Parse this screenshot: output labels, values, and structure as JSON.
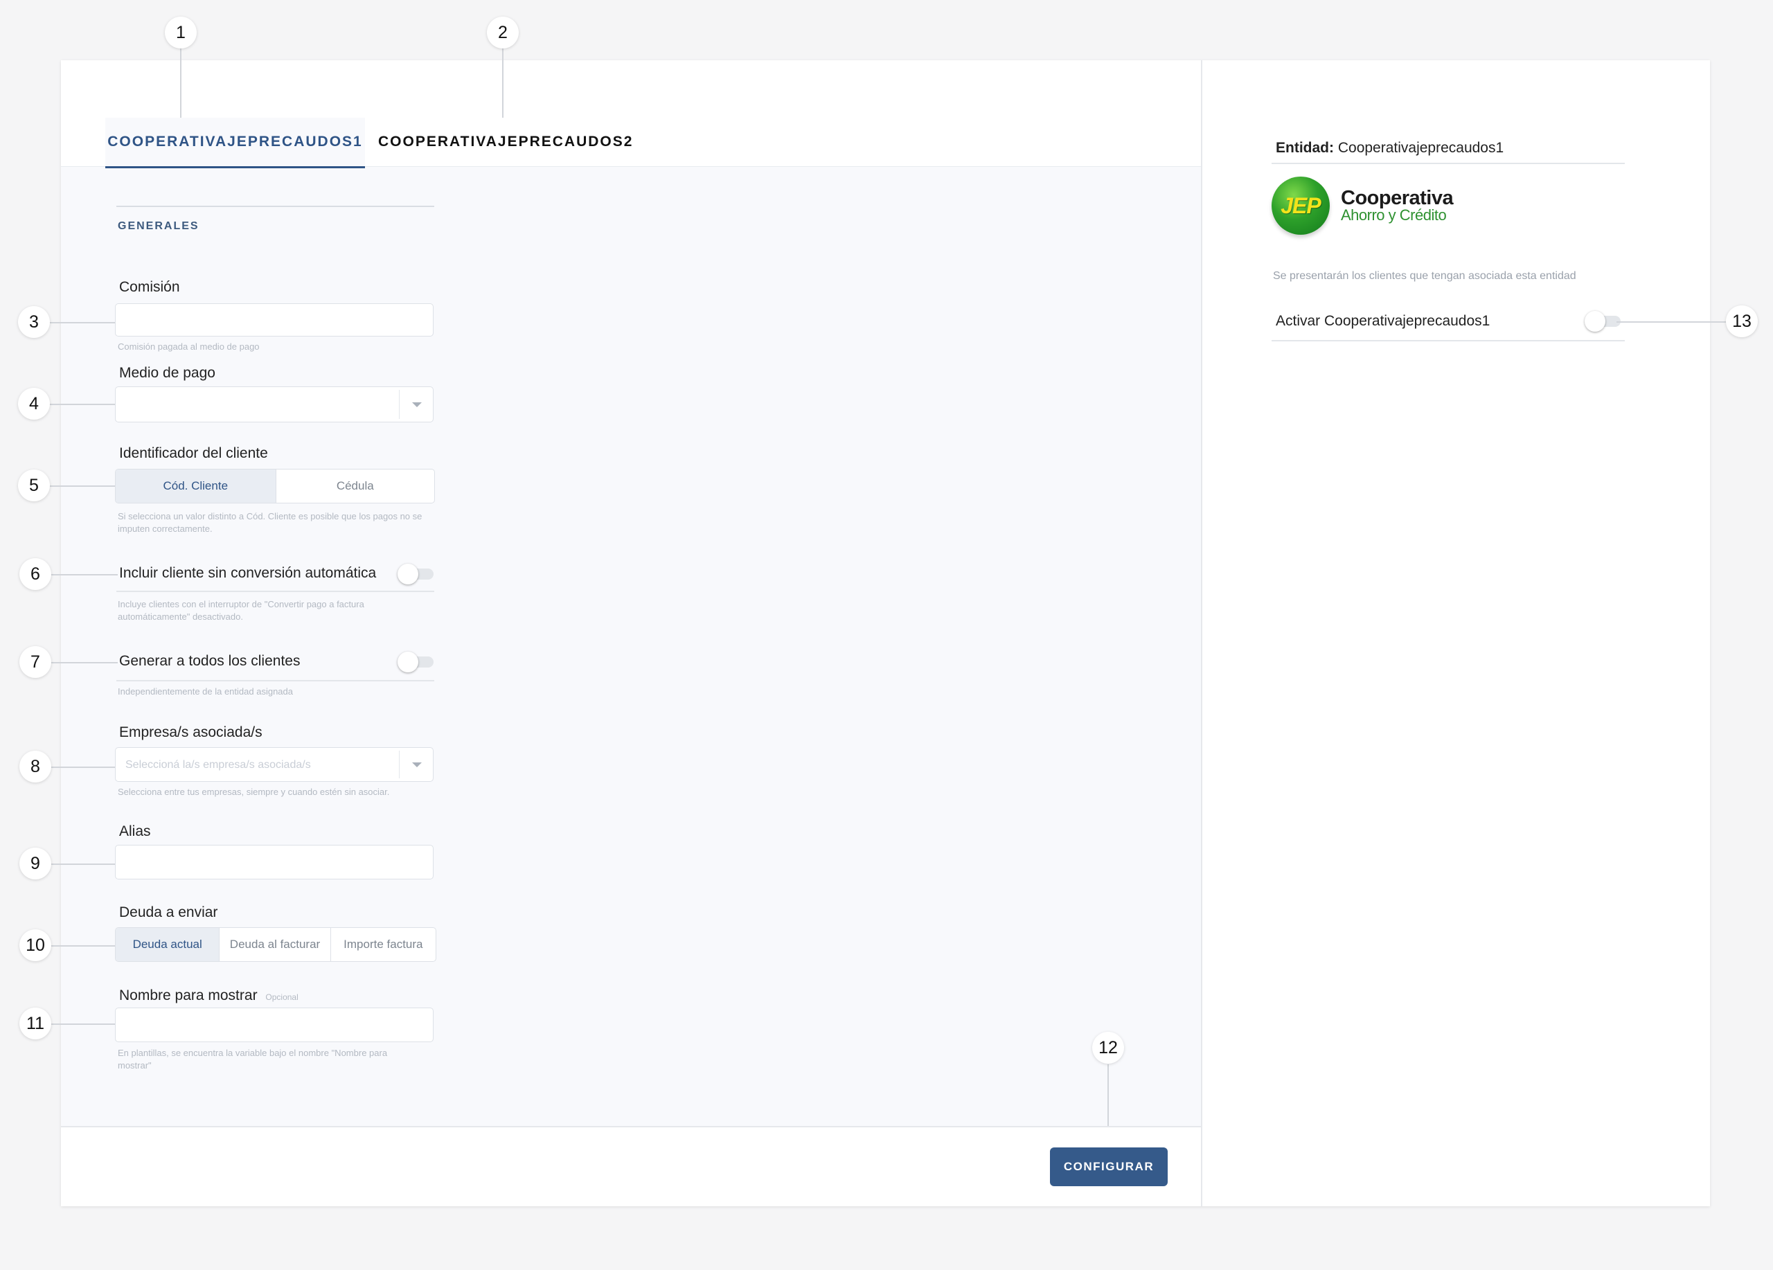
{
  "tabs": [
    {
      "label": "COOPERATIVAJEPRECAUDOS1",
      "active": true
    },
    {
      "label": "COOPERATIVAJEPRECAUDOS2",
      "active": false
    }
  ],
  "section": {
    "title": "GENERALES"
  },
  "fields": {
    "comision": {
      "label": "Comisión",
      "value": "",
      "help": "Comisión pagada al medio de pago"
    },
    "medio_pago": {
      "label": "Medio de pago",
      "value": ""
    },
    "identificador": {
      "label": "Identificador del cliente",
      "options": [
        "Cód. Cliente",
        "Cédula"
      ],
      "selected": "Cód. Cliente",
      "help": "Si selecciona un valor distinto a Cód. Cliente es posible que los pagos no se imputen correctamente."
    },
    "incluir_cliente": {
      "label": "Incluir cliente sin conversión automática",
      "checked": false,
      "help": "Incluye clientes con el interruptor de \"Convertir pago a factura automáticamente\" desactivado."
    },
    "generar_todos": {
      "label": "Generar a todos los clientes",
      "checked": false,
      "help": "Independientemente de la entidad asignada"
    },
    "empresas": {
      "label": "Empresa/s asociada/s",
      "placeholder": "Seleccioná la/s empresa/s asociada/s",
      "help": "Selecciona entre tus empresas, siempre y cuando estén sin asociar."
    },
    "alias": {
      "label": "Alias",
      "value": ""
    },
    "deuda": {
      "label": "Deuda a enviar",
      "options": [
        "Deuda actual",
        "Deuda al facturar",
        "Importe factura"
      ],
      "selected": "Deuda actual"
    },
    "nombre_mostrar": {
      "label": "Nombre para mostrar",
      "optional": "Opcional",
      "value": "",
      "help": "En plantillas, se encuentra la variable bajo el nombre \"Nombre para mostrar\""
    }
  },
  "footer": {
    "button_label": "CONFIGURAR"
  },
  "entity_panel": {
    "entidad_label": "Entidad:",
    "entidad_value": "Cooperativajeprecaudos1",
    "logo": {
      "mark": "JEP",
      "line1": "Cooperativa",
      "line2": "Ahorro y Crédito",
      "colors": {
        "ball": "#2da02a",
        "mark": "#f3e31b",
        "line2": "#2e9130"
      }
    },
    "help": "Se presentarán los clientes que tengan asociada esta entidad",
    "activar_label": "Activar Cooperativajeprecaudos1",
    "activar_checked": false
  },
  "callouts": [
    "1",
    "2",
    "3",
    "4",
    "5",
    "6",
    "7",
    "8",
    "9",
    "10",
    "11",
    "12",
    "13"
  ],
  "colors": {
    "accent": "#2f5486",
    "button": "#355a8a",
    "background": "#f5f5f6",
    "form_background": "#f8f9fc"
  }
}
